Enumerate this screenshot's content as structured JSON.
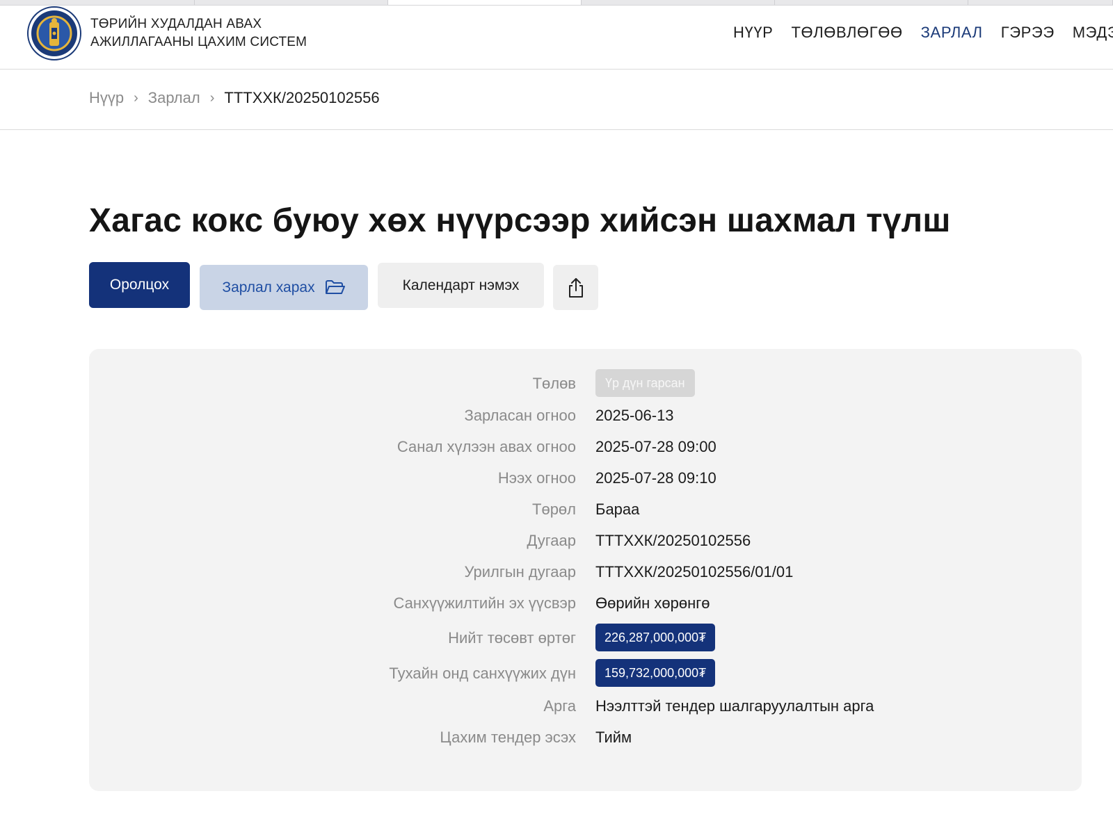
{
  "header": {
    "brand_line1": "ТӨРИЙН ХУДАЛДАН АВАХ",
    "brand_line2": "АЖИЛЛАГААНЫ ЦАХИМ СИСТЕМ",
    "nav": [
      {
        "label": "НҮҮР"
      },
      {
        "label": "ТӨЛӨВЛӨГӨӨ"
      },
      {
        "label": "ЗАРЛАЛ"
      },
      {
        "label": "ГЭРЭЭ"
      },
      {
        "label": "МЭДЭ"
      }
    ],
    "active_nav": "ЗАРЛАЛ"
  },
  "breadcrumb": {
    "items": [
      "Нүүр",
      "Зарлал"
    ],
    "current": "ТТТХХК/20250102556"
  },
  "page": {
    "title": "Хагас кокс буюу хөх нүүрсээр хийсэн шахмал түлш"
  },
  "actions": {
    "participate": "Оролцох",
    "view_notice": "Зарлал харах",
    "add_calendar": "Календарт нэмэх"
  },
  "details": {
    "status_label": "Төлөв",
    "status_value": "Үр дүн гарсан",
    "announced_label": "Зарласан огноо",
    "announced_value": "2025-06-13",
    "deadline_label": "Санал хүлээн авах огноо",
    "deadline_value": "2025-07-28 09:00",
    "opening_label": "Нээх огноо",
    "opening_value": "2025-07-28 09:10",
    "type_label": "Төрөл",
    "type_value": "Бараа",
    "number_label": "Дугаар",
    "number_value": "ТТТХХК/20250102556",
    "invitation_label": "Урилгын дугаар",
    "invitation_value": "ТТТХХК/20250102556/01/01",
    "funding_label": "Санхүүжилтийн эх үүсвэр",
    "funding_value": "Өөрийн хөрөнгө",
    "budget_label": "Нийт төсөвт өртөг",
    "budget_value": "226,287,000,000₮",
    "yearly_label": "Тухайн онд санхүүжих дүн",
    "yearly_value": "159,732,000,000₮",
    "method_label": "Арга",
    "method_value": "Нээлттэй тендер шалгаруулалтын арга",
    "etender_label": "Цахим тендер эсэх",
    "etender_value": "Тийм"
  },
  "colors": {
    "primary": "#14327a",
    "view_button_bg": "#c9d4e6",
    "panel_bg": "#f3f3f3",
    "status_badge_bg": "#d6d6d6"
  }
}
